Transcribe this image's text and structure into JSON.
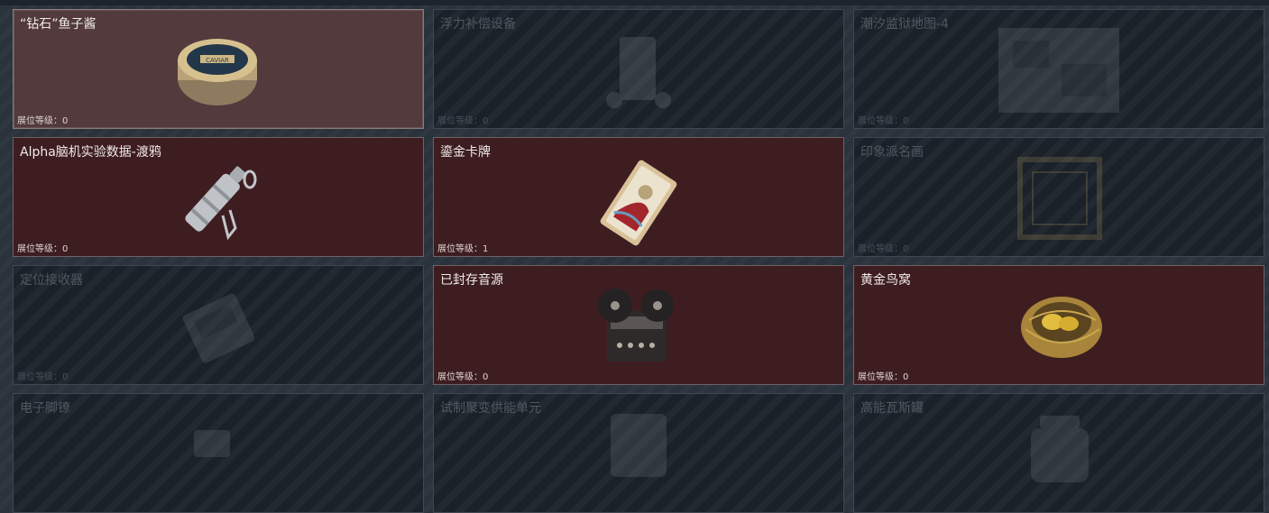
{
  "items": [
    {
      "name": "“钻石”鱼子酱",
      "level": "展位等级：0",
      "state": "filled-selected",
      "icon": "caviar-tin-icon"
    },
    {
      "name": "浮力补偿设备",
      "level": "展位等级：0",
      "state": "empty",
      "icon": "buoyancy-device-icon"
    },
    {
      "name": "潮汐监狱地图-4",
      "level": "展位等级：0",
      "state": "empty",
      "icon": "map-icon"
    },
    {
      "name": "Alpha脑机实验数据-渡鸦",
      "level": "展位等级：0",
      "state": "filled",
      "icon": "data-drive-icon"
    },
    {
      "name": "鎏金卡牌",
      "level": "展位等级：1",
      "state": "filled",
      "icon": "gilded-card-icon"
    },
    {
      "name": "印象派名画",
      "level": "展位等级：0",
      "state": "empty",
      "icon": "painting-icon"
    },
    {
      "name": "定位接收器",
      "level": "展位等级：0",
      "state": "empty",
      "icon": "receiver-icon"
    },
    {
      "name": "已封存音源",
      "level": "展位等级：0",
      "state": "filled",
      "icon": "reel-recorder-icon"
    },
    {
      "name": "黄金鸟窝",
      "level": "展位等级：0",
      "state": "filled",
      "icon": "golden-nest-icon"
    },
    {
      "name": "电子脚镣",
      "level": "",
      "state": "empty",
      "icon": "ankle-monitor-icon"
    },
    {
      "name": "试制聚变供能单元",
      "level": "",
      "state": "empty",
      "icon": "fusion-unit-icon"
    },
    {
      "name": "高能瓦斯罐",
      "level": "",
      "state": "empty",
      "icon": "gas-canister-icon"
    }
  ],
  "colors": {
    "filled": "#3e1d21",
    "selected": "#533a3c",
    "empty": "#1a2128"
  }
}
